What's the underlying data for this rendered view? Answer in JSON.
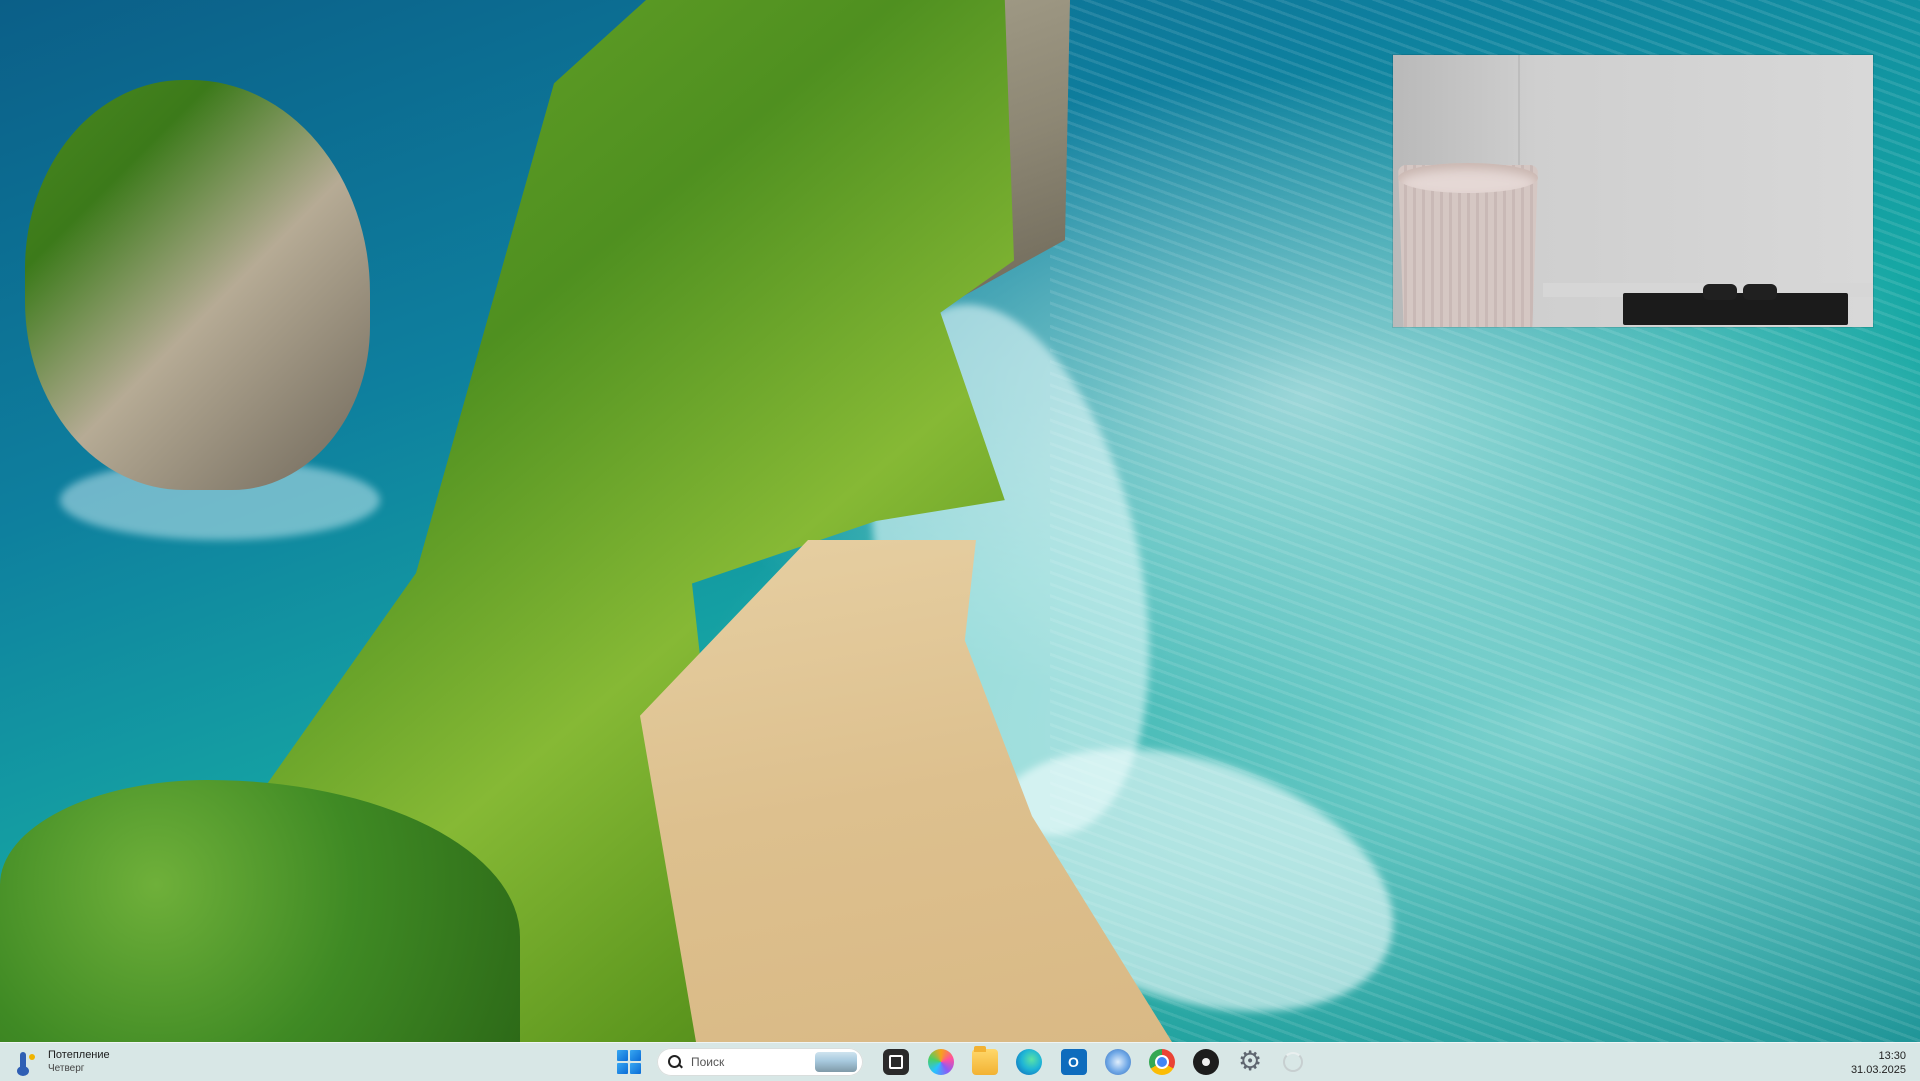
{
  "desktop": {
    "wallpaper": "coastal-cliff-and-ocean"
  },
  "pip_video": {
    "content": "video-frame"
  },
  "taskbar": {
    "weather": {
      "title": "Потепление",
      "subtitle": "Четверг",
      "icon": "thermometer-sun-icon"
    },
    "start": {
      "icon": "windows-start-icon"
    },
    "search": {
      "placeholder": "Поиск",
      "icon": "search-icon"
    },
    "pinned_apps": [
      {
        "name": "task-view",
        "icon": "task-view-icon"
      },
      {
        "name": "copilot",
        "icon": "copilot-icon"
      },
      {
        "name": "file-explorer",
        "icon": "folder-icon"
      },
      {
        "name": "edge",
        "icon": "edge-icon"
      },
      {
        "name": "outlook",
        "icon": "outlook-icon"
      },
      {
        "name": "app",
        "icon": "globe-icon"
      },
      {
        "name": "chrome",
        "icon": "chrome-icon"
      },
      {
        "name": "app-dark",
        "icon": "circle-icon"
      },
      {
        "name": "settings",
        "icon": "gear-icon"
      },
      {
        "name": "loading",
        "icon": "spinner-icon"
      }
    ],
    "clock": {
      "time": "13:30",
      "date": "31.03.2025"
    }
  },
  "colors": {
    "taskbar_bg": "#e8f0ee",
    "start_blue": "#0b6cd6"
  }
}
